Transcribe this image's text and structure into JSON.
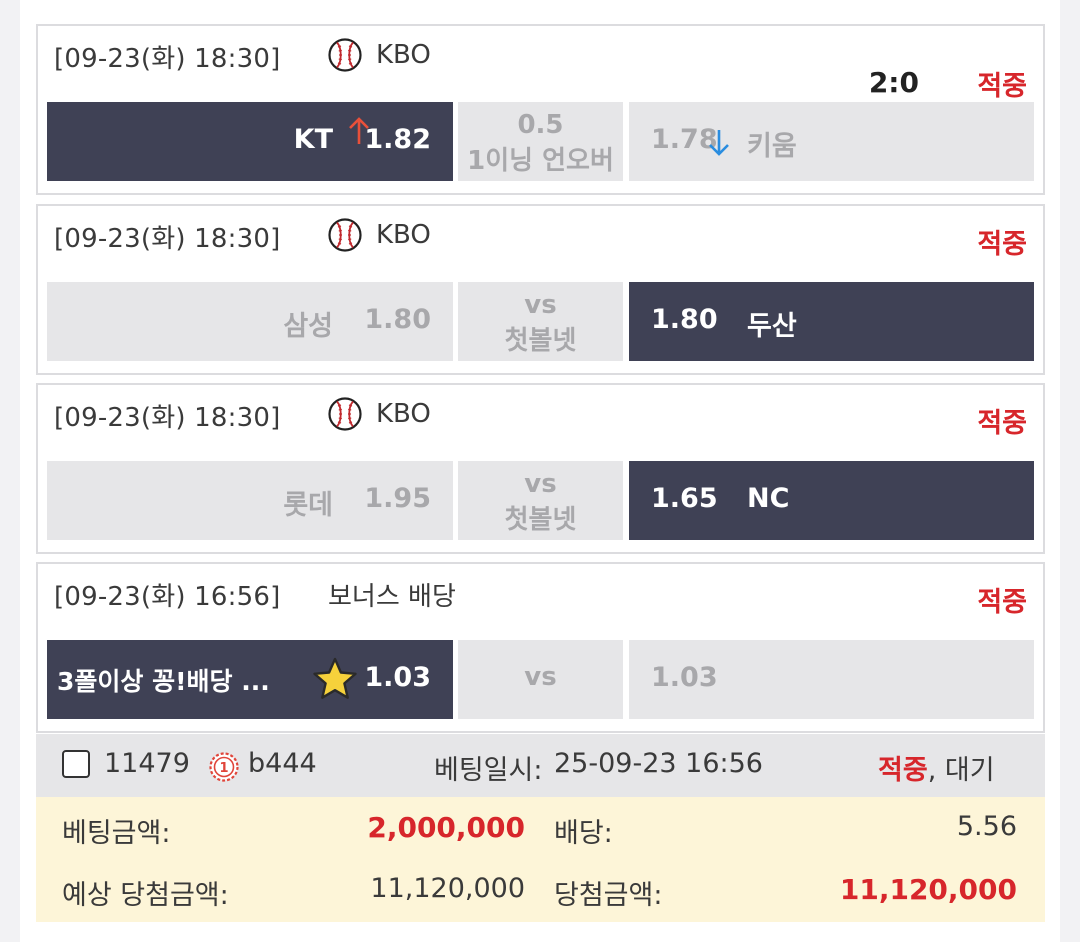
{
  "colors": {
    "selected": "#3f4155",
    "unselected": "#e6e6e8",
    "win": "#d7262b",
    "up_arrow": "#e8503a",
    "down_arrow": "#2a8de0",
    "summary_bg": "#fdf5d8"
  },
  "games": [
    {
      "date": "[09-23(화) 18:30]",
      "league": "KBO",
      "league_icon": "baseball-icon",
      "score": "2:0",
      "result": "적중",
      "home": {
        "team": "KT",
        "odds": "1.82",
        "trend": "up",
        "selected": true
      },
      "middle": {
        "line1": "0.5",
        "line2": "1이닝 언오버"
      },
      "away": {
        "odds": "1.78",
        "trend": "down",
        "team": "키움",
        "selected": false
      }
    },
    {
      "date": "[09-23(화) 18:30]",
      "league": "KBO",
      "league_icon": "baseball-icon",
      "result": "적중",
      "home": {
        "team": "삼성",
        "odds": "1.80",
        "selected": false
      },
      "middle": {
        "line1": "vs",
        "line2": "첫볼넷"
      },
      "away": {
        "odds": "1.80",
        "team": "두산",
        "selected": true
      }
    },
    {
      "date": "[09-23(화) 18:30]",
      "league": "KBO",
      "league_icon": "baseball-icon",
      "result": "적중",
      "home": {
        "team": "롯데",
        "odds": "1.95",
        "selected": false
      },
      "middle": {
        "line1": "vs",
        "line2": "첫볼넷"
      },
      "away": {
        "odds": "1.65",
        "team": "NC",
        "selected": true
      }
    },
    {
      "date": "[09-23(화) 16:56]",
      "league": "보너스 배당",
      "result": "적중",
      "home": {
        "team": "3폴이상 꽁!배당 ...",
        "odds": "1.03",
        "icon": "star-icon",
        "selected": true
      },
      "middle": {
        "line1": "vs"
      },
      "away": {
        "odds": "1.03",
        "selected": false
      }
    }
  ],
  "summary": {
    "bet_id": "11479",
    "user_level": "1",
    "user": "b444",
    "bet_time_label": "베팅일시:",
    "bet_time": "25-09-23 16:56",
    "status_win": "적중",
    "status_rest": ", 대기",
    "bet_amount_label": "베팅금액:",
    "bet_amount": "2,000,000",
    "odds_label": "배당:",
    "odds": "5.56",
    "expected_label": "예상 당첨금액:",
    "expected": "11,120,000",
    "won_label": "당첨금액:",
    "won": "11,120,000"
  }
}
